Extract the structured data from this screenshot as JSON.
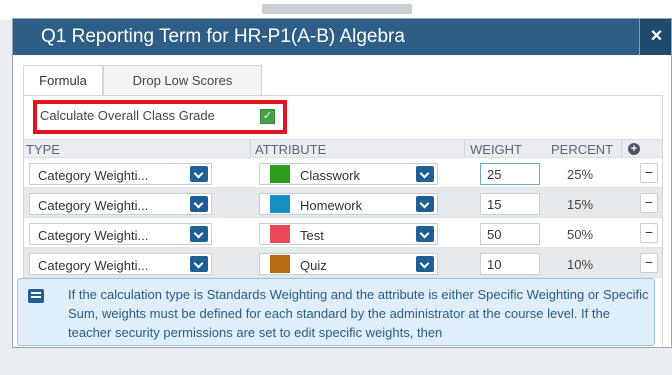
{
  "dialog": {
    "title": "Q1 Reporting Term for HR-P1(A-B) Algebra",
    "close_label": "×"
  },
  "tabs": [
    {
      "label": "Formula",
      "active": true
    },
    {
      "label": "Drop Low Scores",
      "active": false
    }
  ],
  "calculate": {
    "label": "Calculate Overall Class Grade",
    "checked": true,
    "check_glyph": "✓"
  },
  "columns": {
    "type": "TYPE",
    "attribute": "ATTRIBUTE",
    "weight": "WEIGHT",
    "percent": "PERCENT",
    "add_icon": "plus-circle-icon"
  },
  "rows": [
    {
      "type": "Category Weighti...",
      "attribute": "Classwork",
      "color": "#2e9b1e",
      "weight": "25",
      "percent": "25%",
      "remove": "−"
    },
    {
      "type": "Category Weighti...",
      "attribute": "Homework",
      "color": "#1a8fc4",
      "weight": "15",
      "percent": "15%",
      "remove": "−"
    },
    {
      "type": "Category Weighti...",
      "attribute": "Test",
      "color": "#e84a5a",
      "weight": "50",
      "percent": "50%",
      "remove": "−"
    },
    {
      "type": "Category Weighti...",
      "attribute": "Quiz",
      "color": "#b86a10",
      "weight": "10",
      "percent": "10%",
      "remove": "−"
    }
  ],
  "info": {
    "text": "If the calculation type is Standards Weighting and the attribute is either Specific Weighting or Specific Sum, weights must be defined for each standard by the administrator at the course level. If the teacher security permissions are set to edit specific weights, then"
  },
  "colors": {
    "titlebar": "#2e5d86",
    "highlight": "#e3131f",
    "dropdown": "#1f5f95",
    "info_bg": "#dfeef8"
  }
}
